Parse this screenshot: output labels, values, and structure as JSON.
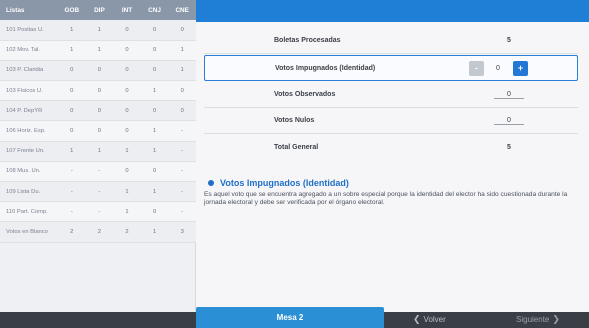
{
  "table": {
    "headers": [
      "Listas",
      "GOB",
      "DIP",
      "INT",
      "CNJ",
      "CNE"
    ],
    "rows": [
      [
        "101 Positas U.",
        "1",
        "1",
        "0",
        "0",
        "0"
      ],
      [
        "102 Mov. Tal.",
        "1",
        "1",
        "0",
        "0",
        "1"
      ],
      [
        "103 P. Claridia",
        "0",
        "0",
        "0",
        "0",
        "1"
      ],
      [
        "103 Fisicos U.",
        "0",
        "0",
        "0",
        "1",
        "0"
      ],
      [
        "104 P. DepYR",
        "0",
        "0",
        "0",
        "0",
        "0"
      ],
      [
        "106 Horiz. Esp.",
        "0",
        "0",
        "0",
        "1",
        "-"
      ],
      [
        "107 Frente Un.",
        "1",
        "1",
        "1",
        "1",
        "-"
      ],
      [
        "108 Mus. Un.",
        "-",
        "-",
        "0",
        "0",
        "-"
      ],
      [
        "109 Lista Du.",
        "-",
        "-",
        "1",
        "1",
        "-"
      ],
      [
        "110 Part. Comp.",
        "-",
        "-",
        "1",
        "0",
        "-"
      ],
      [
        "Votos en Blanco",
        "2",
        "2",
        "2",
        "1",
        "3"
      ]
    ]
  },
  "summary": {
    "boletas_label": "Boletas Procesadas",
    "boletas_value": "5",
    "impugnados_label": "Votos Impugnados (Identidad)",
    "impugnados_value": "0",
    "minus_label": "-",
    "plus_label": "+",
    "observados_label": "Votos Observados",
    "observados_value": "0",
    "nulos_label": "Votos Nulos",
    "nulos_value": "0",
    "total_label": "Total General",
    "total_value": "5"
  },
  "info": {
    "title": "Votos Impugnados (Identidad)",
    "text": "Es aquel voto que se encuentra agregado a un sobre especial porque la identidad del elector ha sido cuestionada durante la jornada electoral y debe ser verificada por el órgano electoral."
  },
  "nav": {
    "mesa_label": "Mesa 2",
    "back_label": "Volver",
    "next_label": "Siguiente"
  },
  "colors": {
    "accent": "#1f7fd6",
    "header": "#8a97a8"
  }
}
